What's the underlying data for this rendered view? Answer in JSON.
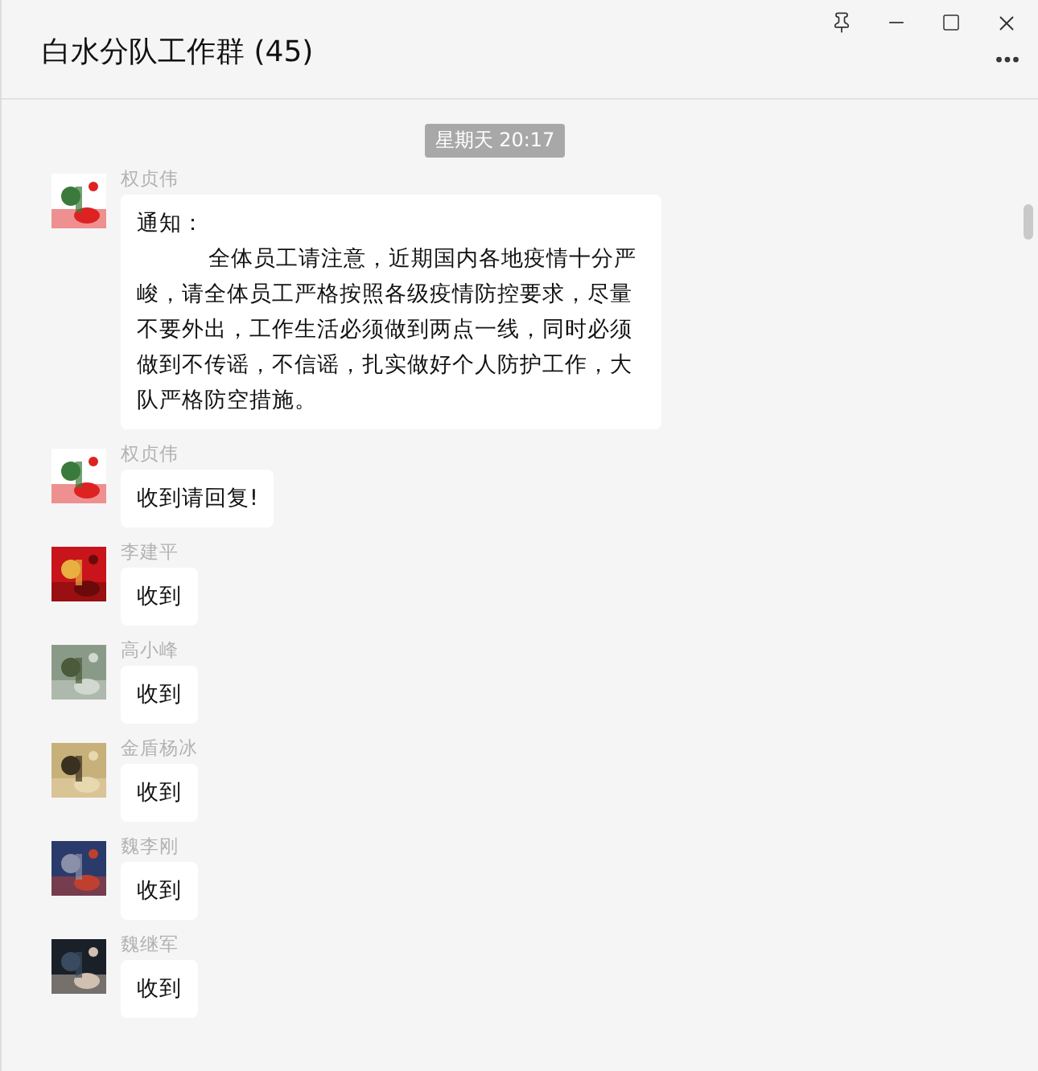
{
  "window": {
    "title": "白水分队工作群 (45)"
  },
  "chat": {
    "timestamp": "星期天 20:17",
    "messages": [
      {
        "sender": "权贞伟",
        "kind": "notice",
        "heading": "通知：",
        "body": "全体员工请注意，近期国内各地疫情十分严峻，请全体员工严格按照各级疫情防控要求，尽量不要外出，工作生活必须做到两点一线，同时必须做到不传谣，不信谣，扎实做好个人防护工作，大队严格防空措施。"
      },
      {
        "sender": "权贞伟",
        "kind": "text",
        "body": "收到请回复!"
      },
      {
        "sender": "李建平",
        "kind": "text",
        "body": "收到"
      },
      {
        "sender": "高小峰",
        "kind": "text",
        "body": "收到"
      },
      {
        "sender": "金盾杨冰",
        "kind": "text",
        "body": "收到"
      },
      {
        "sender": "魏李刚",
        "kind": "text",
        "body": "收到"
      },
      {
        "sender": "魏继军",
        "kind": "text",
        "body": "收到"
      }
    ]
  }
}
